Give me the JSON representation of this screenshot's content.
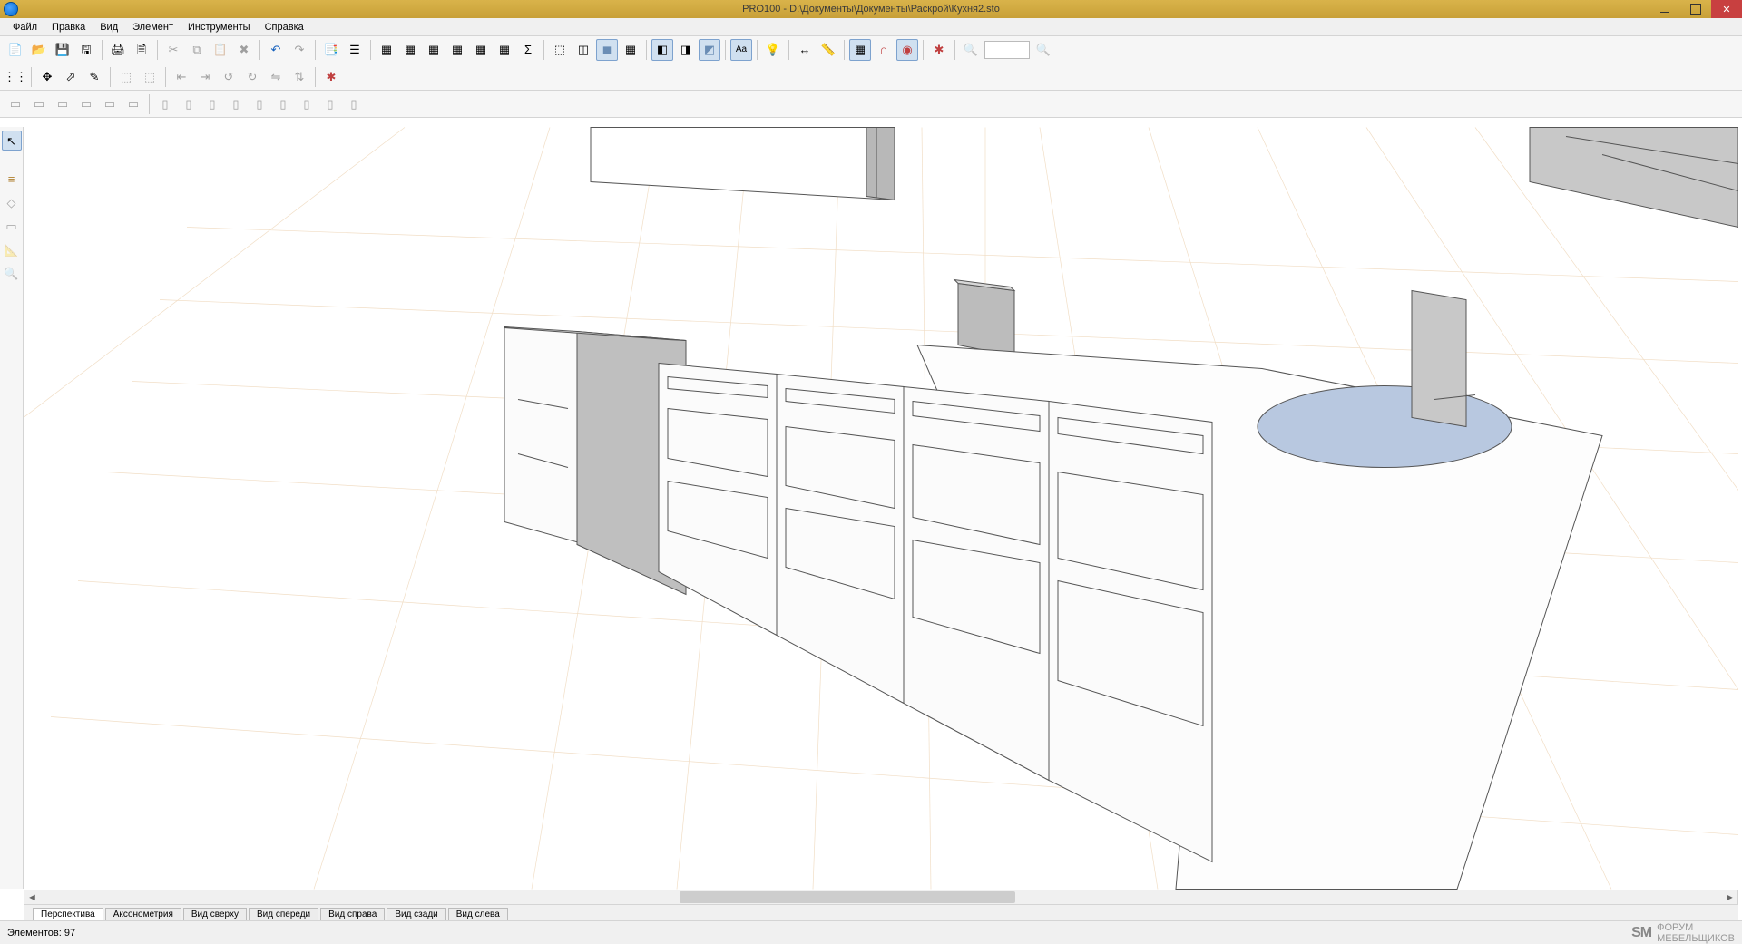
{
  "window": {
    "title": "PRO100 - D:\\Документы\\Документы\\Раскрой\\Кухня2.sto"
  },
  "menu": {
    "file": "Файл",
    "edit": "Правка",
    "view": "Вид",
    "element": "Элемент",
    "tools": "Инструменты",
    "help": "Справка"
  },
  "viewtabs": {
    "perspective": "Перспектива",
    "axonometry": "Аксонометрия",
    "top": "Вид сверху",
    "front": "Вид спереди",
    "right": "Вид справа",
    "back": "Вид сзади",
    "left": "Вид слева"
  },
  "status": {
    "elements_label": "Элементов:",
    "elements_count": "97"
  },
  "watermark": {
    "line1": "ФОРУМ",
    "line2": "МЕБЕЛЬЩИКОВ"
  },
  "zoom": {
    "value": ""
  }
}
